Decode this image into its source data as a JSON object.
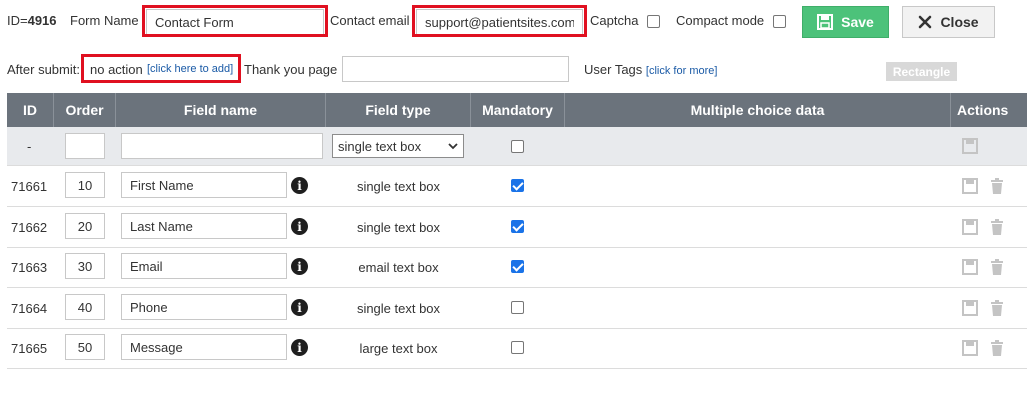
{
  "header": {
    "id_label": "ID=",
    "id_value": "4916",
    "form_name_label": "Form Name",
    "form_name_value": "Contact Form",
    "contact_email_label": "Contact email",
    "contact_email_value": "support@patientsites.com",
    "captcha_label": "Captcha",
    "captcha_checked": false,
    "compact_label": "Compact mode",
    "compact_checked": false,
    "save_label": "Save",
    "close_label": "Close",
    "after_submit_label": "After submit:",
    "after_submit_value": "no action",
    "after_submit_link": "[click here to add]",
    "thank_you_label": "Thank you page",
    "thank_you_value": "",
    "user_tags_label": "User Tags",
    "user_tags_link": "[click for more]",
    "rectangle_label": "Rectangle"
  },
  "table": {
    "columns": [
      "ID",
      "Order",
      "Field name",
      "Field type",
      "Mandatory",
      "Multiple choice data",
      "Actions"
    ],
    "new_row": {
      "id": "-",
      "order": "",
      "name": "",
      "type_select": "single text box",
      "mandatory": false
    },
    "rows": [
      {
        "id": "71661",
        "order": "10",
        "name": "First Name",
        "type": "single text box",
        "mandatory": true
      },
      {
        "id": "71662",
        "order": "20",
        "name": "Last Name",
        "type": "single text box",
        "mandatory": true
      },
      {
        "id": "71663",
        "order": "30",
        "name": "Email",
        "type": "email text box",
        "mandatory": true
      },
      {
        "id": "71664",
        "order": "40",
        "name": "Phone",
        "type": "single text box",
        "mandatory": false
      },
      {
        "id": "71665",
        "order": "50",
        "name": "Message",
        "type": "large text box",
        "mandatory": false
      }
    ]
  },
  "colors": {
    "save_green": "#4cc27a",
    "header_gray": "#6b737c",
    "highlight_red": "#e01020",
    "checkbox_blue": "#1a73e8"
  },
  "icons": {
    "save": "floppy-disk-icon",
    "close": "x-icon",
    "info": "info-circle-icon",
    "trash": "trash-icon",
    "dropdown": "chevron-down-icon"
  }
}
